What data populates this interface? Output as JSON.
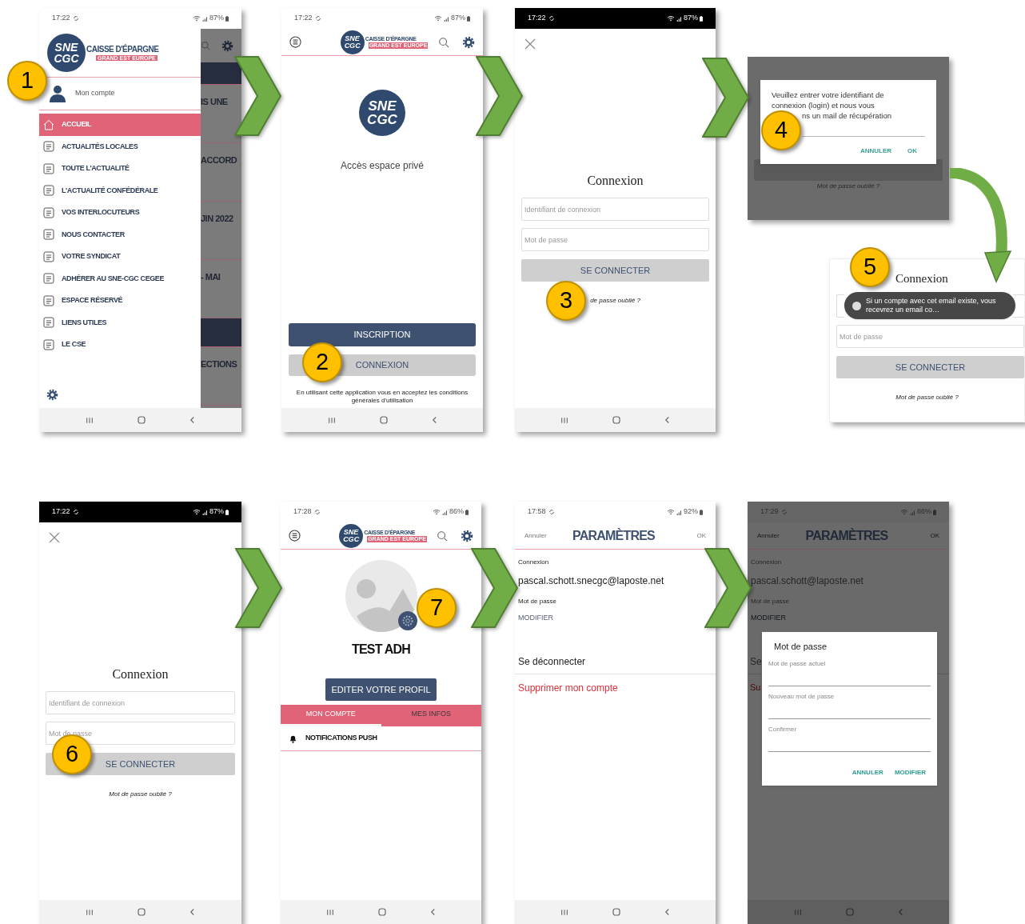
{
  "callouts": [
    "1",
    "2",
    "3",
    "4",
    "5",
    "6",
    "7"
  ],
  "screens": [
    {
      "kind": "drawer",
      "status": {
        "time": "17:22",
        "battery": "87%",
        "dark": false
      },
      "logo": {
        "emblem": [
          "SNE",
          "CGC"
        ],
        "name": "CAISSE D'ÉPARGNE",
        "tag": "GRAND EST EUROPE"
      },
      "account": "Mon compte",
      "menu": [
        {
          "label": "ACCUEIL",
          "selected": true
        },
        {
          "label": "ACTUALITÉS LOCALES",
          "selected": false
        },
        {
          "label": "TOUTE L'ACTUALITÉ",
          "selected": false
        },
        {
          "label": "L'ACTUALITÉ CONFÉDÉRALE",
          "selected": false
        },
        {
          "label": "VOS INTERLOCUTEURS",
          "selected": false
        },
        {
          "label": "NOUS CONTACTER",
          "selected": false
        },
        {
          "label": "VOTRE SYNDICAT",
          "selected": false
        },
        {
          "label": "ADHÉRER AU SNE-CGC CEGEE",
          "selected": false
        },
        {
          "label": "ESPACE RÉSERVÉ",
          "selected": false
        },
        {
          "label": "LIENS UTILES",
          "selected": false
        },
        {
          "label": "LE CSE",
          "selected": false
        }
      ],
      "behind": [
        "IS UNE",
        "ACCORD",
        "JIN 2022",
        "- MAI",
        "ECTIONS"
      ]
    },
    {
      "kind": "welcome",
      "status": {
        "time": "17:22",
        "battery": "87%",
        "dark": false
      },
      "logo": {
        "emblem": [
          "SNE",
          "CGC"
        ],
        "name": "CAISSE D'ÉPARGNE",
        "tag": "GRAND EST EUROPE"
      },
      "emblem": [
        "SNE",
        "CGC"
      ],
      "title": "Accès espace privé",
      "signup": "INSCRIPTION",
      "login": "CONNEXION",
      "terms": "En utilisant cette application vous en acceptez les conditions générales d'utilisation"
    },
    {
      "kind": "login",
      "status": {
        "time": "17:22",
        "battery": "87%",
        "dark": true
      },
      "title": "Connexion",
      "fields": [
        {
          "placeholder": "Identifiant de connexion"
        },
        {
          "placeholder": "Mot de passe"
        }
      ],
      "submit": "SE CONNECTER",
      "forgot": "de passe oublié ?"
    },
    {
      "kind": "forgot_dialog",
      "message": "Veuillez entrer votre identifiant de connexion (login) et nous vous",
      "message_end": "ns un mail de récupération",
      "buttons": [
        "ANNULER",
        "OK"
      ],
      "forgot": "Mot de passe oublié ?"
    },
    {
      "kind": "login_toast",
      "title": "Connexion",
      "toast": "Si un compte avec cet email existe, vous recevrez un email co…",
      "fields": [
        {
          "placeholder": "Mot de passe"
        }
      ],
      "submit": "SE CONNECTER",
      "forgot": "Mot de passe oublié ?"
    },
    {
      "kind": "login",
      "status": {
        "time": "17:22",
        "battery": "87%",
        "dark": true
      },
      "title": "Connexion",
      "fields": [
        {
          "placeholder": "Identifiant de connexion"
        },
        {
          "placeholder": "Mot de passe"
        }
      ],
      "submit": "SE CONNECTER",
      "forgot": "Mot de passe oublié ?"
    },
    {
      "kind": "profile",
      "status": {
        "time": "17:28",
        "battery": "86%",
        "dark": false
      },
      "logo": {
        "emblem": [
          "SNE",
          "CGC"
        ],
        "name": "CAISSE D'ÉPARGNE",
        "tag": "GRAND EST EUROPE"
      },
      "name": "TEST ADH",
      "edit": "EDITER VOTRE PROFIL",
      "tabs": [
        {
          "label": "MON COMPTE",
          "selected": true
        },
        {
          "label": "MES INFOS",
          "selected": false
        }
      ],
      "items": [
        "NOTIFICATIONS PUSH"
      ]
    },
    {
      "kind": "settings",
      "dimmed": false,
      "status": {
        "time": "17:58",
        "battery": "92%",
        "dark": false
      },
      "cancel": "Annuler",
      "title": "PARAMÈTRES",
      "ok": "OK",
      "login_label": "Connexion",
      "email": "pascal.schott.snecgc@laposte.net",
      "password_label": "Mot de passe",
      "modify": "MODIFIER",
      "logout": "Se déconnecter",
      "delete": "Supprimer mon compte"
    },
    {
      "kind": "settings",
      "dimmed": true,
      "status": {
        "time": "17:29",
        "battery": "86%",
        "dark": false
      },
      "cancel": "Annuler",
      "title": "PARAMÈTRES",
      "ok": "OK",
      "login_label": "Connexion",
      "email": "pascal.schott@laposte.net",
      "password_label": "Mot de passe",
      "modify": "MODIFIER",
      "logout": "Se",
      "delete": "Su",
      "dialog": {
        "title": "Mot de passe",
        "fields": [
          {
            "placeholder": "Mot de passe actuel"
          },
          {
            "placeholder": "Nouveau mot de passe"
          },
          {
            "placeholder": "Confirmer"
          }
        ],
        "buttons": [
          "ANNULER",
          "MODIFIER"
        ]
      }
    }
  ]
}
